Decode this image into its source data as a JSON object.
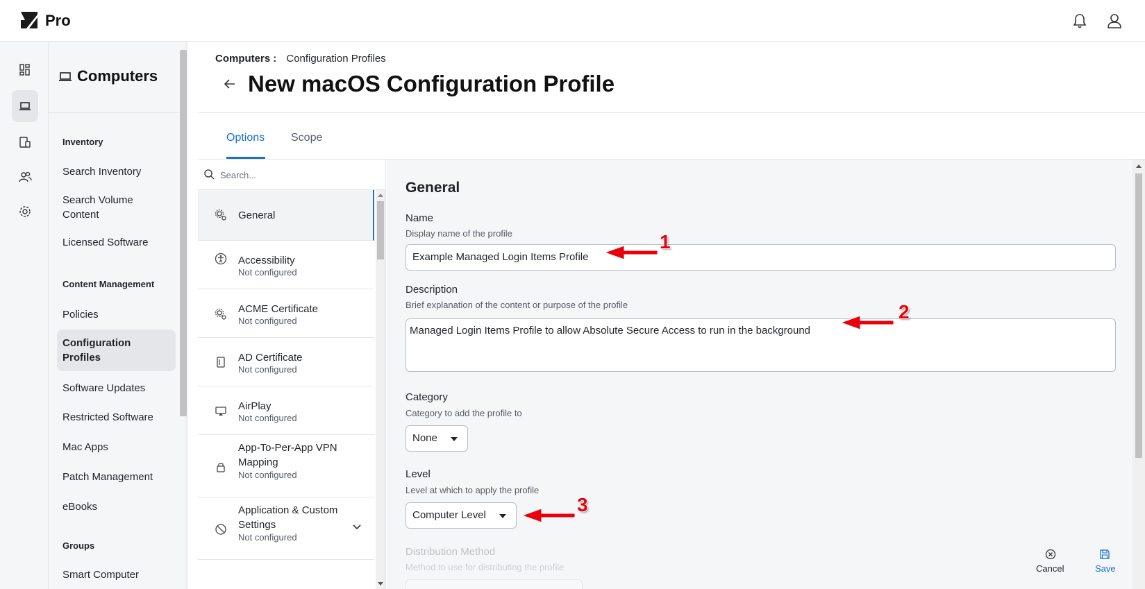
{
  "app": {
    "brand": "Pro"
  },
  "section": {
    "title": "Computers"
  },
  "sidebar": {
    "groups": [
      {
        "label": "Inventory"
      },
      {
        "label": "Content Management"
      },
      {
        "label": "Groups"
      }
    ],
    "items": [
      {
        "label": "Search Inventory"
      },
      {
        "label": "Search Volume Content"
      },
      {
        "label": "Licensed Software"
      },
      {
        "label": "Policies"
      },
      {
        "label": "Configuration Profiles"
      },
      {
        "label": "Software Updates"
      },
      {
        "label": "Restricted Software"
      },
      {
        "label": "Mac Apps"
      },
      {
        "label": "Patch Management"
      },
      {
        "label": "eBooks"
      },
      {
        "label": "Smart Computer"
      }
    ]
  },
  "breadcrumb": {
    "parent": "Computers",
    "separator": ":",
    "current": "Configuration Profiles"
  },
  "page": {
    "title": "New macOS Configuration Profile"
  },
  "tabs": [
    {
      "label": "Options"
    },
    {
      "label": "Scope"
    }
  ],
  "payloads": {
    "search_placeholder": "Search...",
    "items": [
      {
        "name": "General",
        "status": ""
      },
      {
        "name": "Accessibility",
        "status": "Not configured"
      },
      {
        "name": "ACME Certificate",
        "status": "Not configured"
      },
      {
        "name": "AD Certificate",
        "status": "Not configured"
      },
      {
        "name": "AirPlay",
        "status": "Not configured"
      },
      {
        "name": "App-To-Per-App VPN Mapping",
        "status": "Not configured"
      },
      {
        "name": "Application & Custom Settings",
        "status": "Not configured"
      }
    ]
  },
  "form": {
    "title": "General",
    "name_label": "Name",
    "name_hint": "Display name of the profile",
    "name_value": "Example Managed Login Items Profile",
    "description_label": "Description",
    "description_hint": "Brief explanation of the content or purpose of the profile",
    "description_value": "Managed Login Items Profile to allow Absolute Secure Access to run in the background",
    "category_label": "Category",
    "category_hint": "Category to add the profile to",
    "category_value": "None",
    "level_label": "Level",
    "level_hint": "Level at which to apply the profile",
    "level_value": "Computer Level",
    "distribution_label": "Distribution Method",
    "distribution_hint": "Method to use for distributing the profile"
  },
  "annotations": [
    {
      "number": "1"
    },
    {
      "number": "2"
    },
    {
      "number": "3"
    }
  ],
  "actions": {
    "cancel_label": "Cancel",
    "save_label": "Save"
  },
  "colors": {
    "accent": "#1a6fd1",
    "annotation": "#e8000b",
    "panel": "#f5f6f8"
  }
}
